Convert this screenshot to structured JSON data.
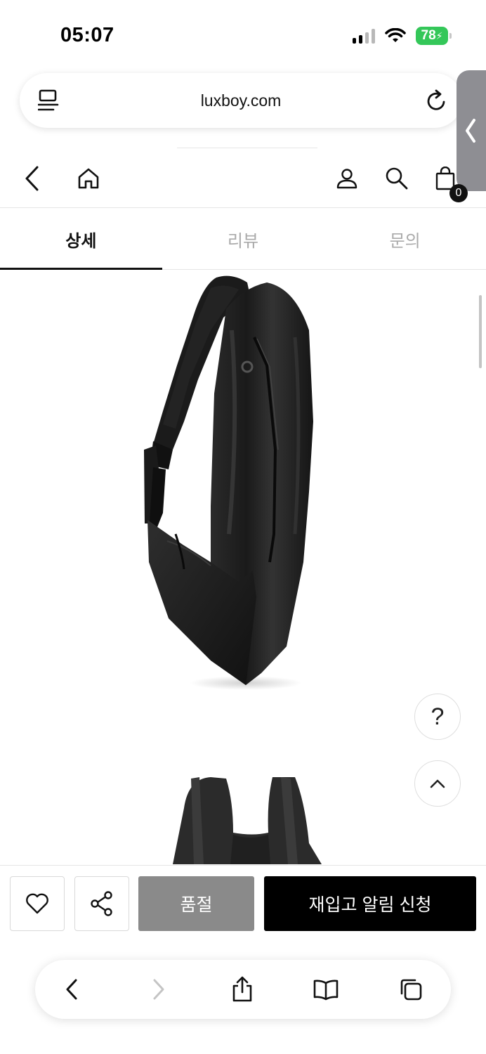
{
  "status_bar": {
    "time": "05:07",
    "battery": "78",
    "icons": [
      "cellular-signal-icon",
      "wifi-icon",
      "battery-charging-icon"
    ]
  },
  "browser": {
    "url": "luxboy.com",
    "left_icon": "page-menu-icon",
    "right_icon": "reload-icon"
  },
  "header": {
    "icons": [
      "back-icon",
      "home-icon",
      "user-icon",
      "search-icon",
      "shopping-bag-icon"
    ],
    "cart_count": "0"
  },
  "tabs": [
    {
      "label": "상세",
      "active": true
    },
    {
      "label": "리뷰",
      "active": false
    },
    {
      "label": "문의",
      "active": false
    }
  ],
  "floating": {
    "help": "?",
    "top_icon": "chevron-up-icon"
  },
  "actions": {
    "wish_icon": "heart-icon",
    "share_icon": "share-icon",
    "soldout_label": "품절",
    "notify_label": "재입고 알림 신청"
  },
  "toolbar": {
    "icons": [
      "back-icon",
      "forward-icon",
      "share-icon",
      "bookmarks-icon",
      "tabs-icon"
    ]
  },
  "colors": {
    "accent_black": "#000000",
    "soldout_gray": "#8a8a8a",
    "battery_green": "#34c759"
  }
}
